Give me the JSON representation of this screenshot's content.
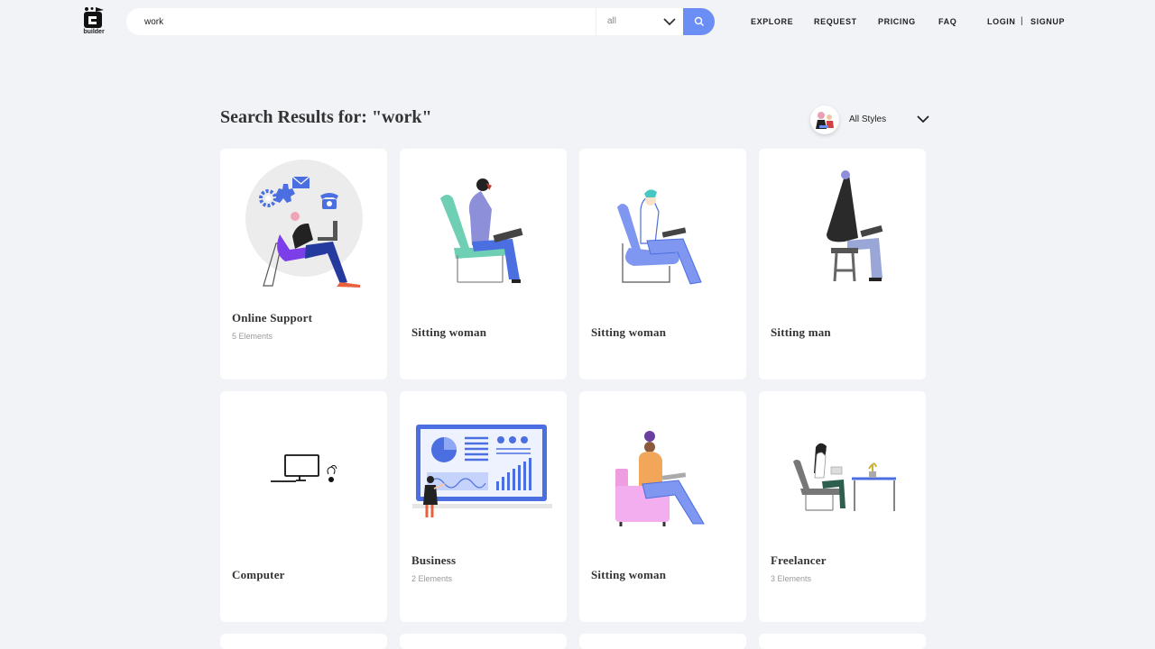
{
  "header": {
    "logo_text": "builder",
    "search": {
      "value": "work",
      "placeholder": "",
      "category": "all"
    },
    "nav": [
      "EXPLORE",
      "REQUEST",
      "PRICING",
      "FAQ"
    ],
    "login": "LOGIN",
    "separator": "|",
    "signup": "SIGNUP"
  },
  "results": {
    "title": "Search Results for: \"work\"",
    "style_filter": "All Styles"
  },
  "cards": [
    {
      "title": "Online Support",
      "subtitle": "5 Elements",
      "illustration": "person-laptop-chair-icons"
    },
    {
      "title": "Sitting woman",
      "subtitle": "",
      "illustration": "woman-teal-chair-laptop"
    },
    {
      "title": "Sitting woman",
      "subtitle": "",
      "illustration": "woman-blue-chair-laptop"
    },
    {
      "title": "Sitting man",
      "subtitle": "",
      "illustration": "man-stool-laptop"
    },
    {
      "title": "Computer",
      "subtitle": "",
      "illustration": "computer-monitor"
    },
    {
      "title": "Business",
      "subtitle": "2 Elements",
      "illustration": "dashboard-presentation"
    },
    {
      "title": "Sitting woman",
      "subtitle": "",
      "illustration": "woman-pink-armchair"
    },
    {
      "title": "Freelancer",
      "subtitle": "3 Elements",
      "illustration": "freelancer-desk"
    }
  ],
  "colors": {
    "accent": "#6b8ef5",
    "background": "#f2f3f7",
    "card": "#ffffff"
  }
}
